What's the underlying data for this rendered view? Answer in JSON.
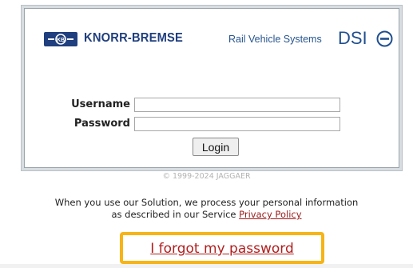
{
  "header": {
    "brand_name": "KNORR-BREMSE",
    "division": "Rail Vehicle Systems",
    "product": "DSI",
    "brand_logo_icon": "knorr-bremse-logo",
    "product_icon": "dsi-circle-minus-icon"
  },
  "form": {
    "username_label": "Username",
    "username_value": "",
    "password_label": "Password",
    "password_value": "",
    "login_button": "Login"
  },
  "footer": {
    "copyright": "© 1999-2024 JAGGAER",
    "privacy_text_1": "When you use our Solution, we process your personal information",
    "privacy_text_2": "as described in our Service ",
    "privacy_link": "Privacy Policy",
    "forgot_password": "I forgot my password"
  },
  "colors": {
    "brand_blue": "#1f3f7e",
    "link_red": "#b01e1e",
    "highlight": "#f6b416"
  }
}
